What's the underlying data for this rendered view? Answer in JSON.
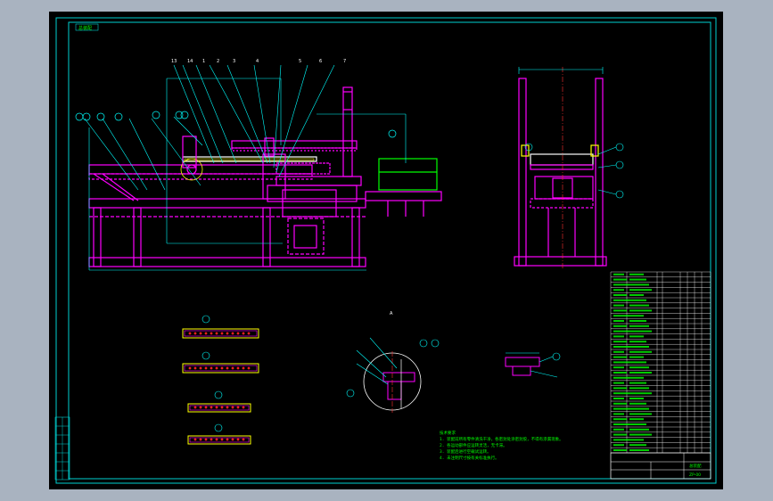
{
  "viewport": {
    "background": "#000000",
    "app_background": "#a9b3c0"
  },
  "colors": {
    "frame": "#00d0d0",
    "geometry": "#ff00ff",
    "annotation": "#00ffff",
    "centerline": "#ff3030",
    "notes": "#00ff00",
    "highlight": "#ffff00",
    "white": "#ffffff",
    "red_dots": "#ff2020"
  },
  "drawing": {
    "top_left_label": "总装配",
    "notes_heading": "技术要求",
    "notes_lines": [
      "1. 装配前所有零件清洗干净，各密封处涂密封胶，不得有渗漏现象。",
      "2. 各运动部件应运转灵活，无卡滞。",
      "3. 装配后进行空载试运转。",
      "4. 未注明尺寸按有关标准执行。"
    ],
    "title_block": {
      "drawing_title": "总装配",
      "drawing_number": "ZP-00"
    },
    "balloons_main": [
      "13",
      "14",
      "1",
      "2",
      "3",
      "4",
      "5",
      "6",
      "7"
    ],
    "section_label": "A"
  }
}
